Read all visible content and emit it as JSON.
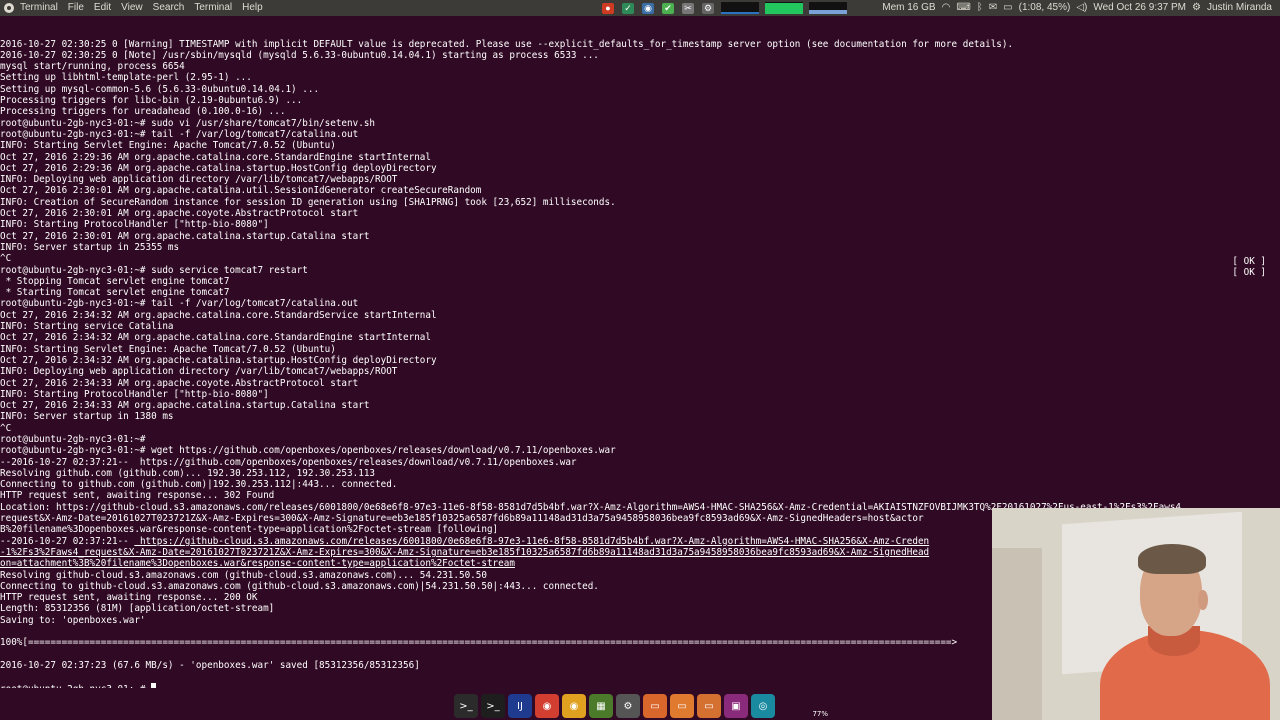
{
  "menubar": {
    "items": [
      "Terminal",
      "File",
      "Edit",
      "View",
      "Search",
      "Terminal",
      "Help"
    ],
    "mem_label": "Mem 16 GB",
    "battery": "(1:08, 45%)",
    "datetime": "Wed Oct 26  9:37 PM",
    "user": "Justin Miranda",
    "colors": {
      "panel": "#3c3b37",
      "text": "#dfdbd2"
    }
  },
  "terminal": {
    "background": "#300a24",
    "lines": [
      "2016-10-27 02:30:25 0 [Warning] TIMESTAMP with implicit DEFAULT value is deprecated. Please use --explicit_defaults_for_timestamp server option (see documentation for more details).",
      "2016-10-27 02:30:25 0 [Note] /usr/sbin/mysqld (mysqld 5.6.33-0ubuntu0.14.04.1) starting as process 6533 ...",
      "mysql start/running, process 6654",
      "Setting up libhtml-template-perl (2.95-1) ...",
      "Setting up mysql-common-5.6 (5.6.33-0ubuntu0.14.04.1) ...",
      "Processing triggers for libc-bin (2.19-0ubuntu6.9) ...",
      "Processing triggers for ureadahead (0.100.0-16) ...",
      "root@ubuntu-2gb-nyc3-01:~# sudo vi /usr/share/tomcat7/bin/setenv.sh",
      "root@ubuntu-2gb-nyc3-01:~# tail -f /var/log/tomcat7/catalina.out",
      "INFO: Starting Servlet Engine: Apache Tomcat/7.0.52 (Ubuntu)",
      "Oct 27, 2016 2:29:36 AM org.apache.catalina.core.StandardEngine startInternal",
      "Oct 27, 2016 2:29:36 AM org.apache.catalina.startup.HostConfig deployDirectory",
      "INFO: Deploying web application directory /var/lib/tomcat7/webapps/ROOT",
      "Oct 27, 2016 2:30:01 AM org.apache.catalina.util.SessionIdGenerator createSecureRandom",
      "INFO: Creation of SecureRandom instance for session ID generation using [SHA1PRNG] took [23,652] milliseconds.",
      "Oct 27, 2016 2:30:01 AM org.apache.coyote.AbstractProtocol start",
      "INFO: Starting ProtocolHandler [\"http-bio-8080\"]",
      "Oct 27, 2016 2:30:01 AM org.apache.catalina.startup.Catalina start",
      "INFO: Server startup in 25355 ms",
      "^C",
      "root@ubuntu-2gb-nyc3-01:~# sudo service tomcat7 restart",
      " * Stopping Tomcat servlet engine tomcat7",
      " * Starting Tomcat servlet engine tomcat7",
      "root@ubuntu-2gb-nyc3-01:~# tail -f /var/log/tomcat7/catalina.out",
      "Oct 27, 2016 2:34:32 AM org.apache.catalina.core.StandardService startInternal",
      "INFO: Starting service Catalina",
      "Oct 27, 2016 2:34:32 AM org.apache.catalina.core.StandardEngine startInternal",
      "INFO: Starting Servlet Engine: Apache Tomcat/7.0.52 (Ubuntu)",
      "Oct 27, 2016 2:34:32 AM org.apache.catalina.startup.HostConfig deployDirectory",
      "INFO: Deploying web application directory /var/lib/tomcat7/webapps/ROOT",
      "Oct 27, 2016 2:34:33 AM org.apache.coyote.AbstractProtocol start",
      "INFO: Starting ProtocolHandler [\"http-bio-8080\"]",
      "Oct 27, 2016 2:34:33 AM org.apache.catalina.startup.Catalina start",
      "INFO: Server startup in 1380 ms",
      "^C",
      "root@ubuntu-2gb-nyc3-01:~#",
      "root@ubuntu-2gb-nyc3-01:~# wget https://github.com/openboxes/openboxes/releases/download/v0.7.11/openboxes.war",
      "--2016-10-27 02:37:21--  https://github.com/openboxes/openboxes/releases/download/v0.7.11/openboxes.war",
      "Resolving github.com (github.com)... 192.30.253.112, 192.30.253.113",
      "Connecting to github.com (github.com)|192.30.253.112|:443... connected.",
      "HTTP request sent, awaiting response... 302 Found",
      "Location: https://github-cloud.s3.amazonaws.com/releases/6001800/0e68e6f8-97e3-11e6-8f58-8581d7d5b4bf.war?X-Amz-Algorithm=AWS4-HMAC-SHA256&X-Amz-Credential=AKIAISTNZFOVBIJMK3TQ%2F20161027%2Fus-east-1%2Fs3%2Faws4_",
      "request&X-Amz-Date=20161027T023721Z&X-Amz-Expires=300&X-Amz-Signature=eb3e185f10325a6587fd6b89a11148ad31d3a75a9458958036bea9fc8593ad69&X-Amz-SignedHeaders=host&actor",
      "B%20filename%3Dopenboxes.war&response-content-type=application%2Foctet-stream [following]",
      "--2016-10-27 02:37:21--  https://github-cloud.s3.amazonaws.com/releases/6001800/0e68e6f8-97e3-11e6-8f58-8581d7d5b4bf.war?X-Amz-Algorithm=AWS4-HMAC-SHA256&X-Amz-Creden",
      "-1%2Fs3%2Faws4_request&X-Amz-Date=20161027T023721Z&X-Amz-Expires=300&X-Amz-Signature=eb3e185f10325a6587fd6b89a11148ad31d3a75a9458958036bea9fc8593ad69&X-Amz-SignedHead",
      "on=attachment%3B%20filename%3Dopenboxes.war&response-content-type=application%2Foctet-stream",
      "Resolving github-cloud.s3.amazonaws.com (github-cloud.s3.amazonaws.com)... 54.231.50.50",
      "Connecting to github-cloud.s3.amazonaws.com (github-cloud.s3.amazonaws.com)|54.231.50.50|:443... connected.",
      "HTTP request sent, awaiting response... 200 OK",
      "Length: 85312356 (81M) [application/octet-stream]",
      "Saving to: 'openboxes.war'",
      "",
      "100%[=====================================================================================================================================================================>",
      "",
      "2016-10-27 02:37:23 (67.6 MB/s) - 'openboxes.war' saved [85312356/85312356]",
      "",
      "root@ubuntu-2gb-nyc3-01:~# "
    ],
    "ok_label": "[ OK ]"
  },
  "webcam": {
    "icon": "webcam-person"
  },
  "dock": {
    "apps": [
      {
        "name": "terminal-icon",
        "glyph": ">_",
        "color": "#2b2b2b"
      },
      {
        "name": "terminal2-icon",
        "glyph": ">_",
        "color": "#1e1e1e"
      },
      {
        "name": "intellij-icon",
        "glyph": "IJ",
        "color": "#1f3b8f"
      },
      {
        "name": "chrome-icon",
        "glyph": "◉",
        "color": "#d23f31"
      },
      {
        "name": "chrome2-icon",
        "glyph": "◉",
        "color": "#e0a020"
      },
      {
        "name": "apps-icon",
        "glyph": "▦",
        "color": "#4a7a2a"
      },
      {
        "name": "settings-icon",
        "glyph": "⚙",
        "color": "#555555"
      },
      {
        "name": "files-icon",
        "glyph": "▭",
        "color": "#d9672b"
      },
      {
        "name": "folder-icon",
        "glyph": "▭",
        "color": "#e07a2f"
      },
      {
        "name": "folder2-icon",
        "glyph": "▭",
        "color": "#d47030"
      },
      {
        "name": "app-icon",
        "glyph": "▣",
        "color": "#8a2a7a"
      },
      {
        "name": "network-icon",
        "glyph": "◎",
        "color": "#1a8aa0"
      }
    ],
    "badge": "77%"
  }
}
